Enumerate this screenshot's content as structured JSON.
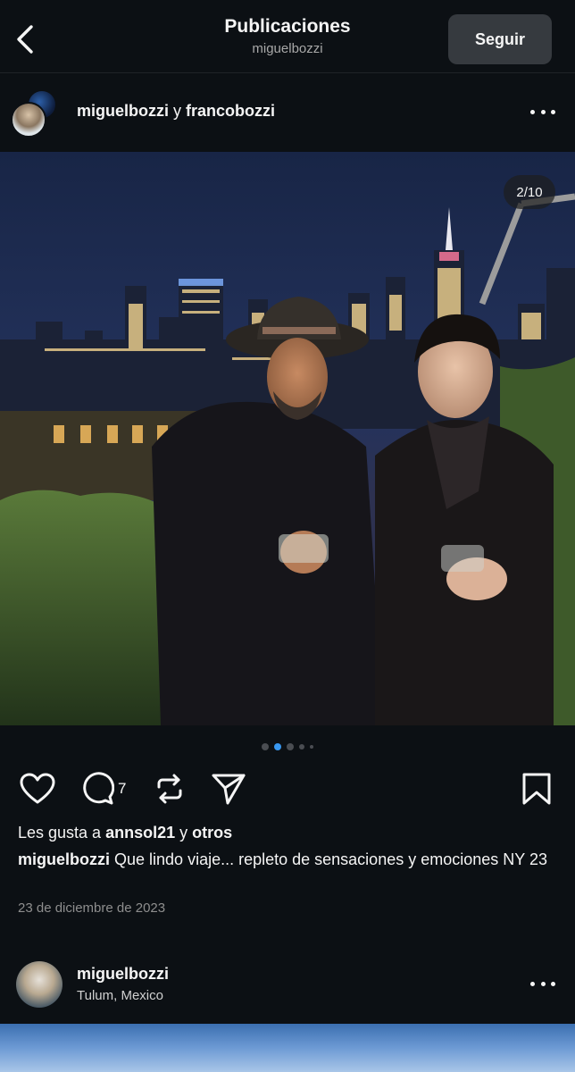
{
  "header": {
    "title": "Publicaciones",
    "subtitle": "miguelbozzi",
    "follow_label": "Seguir"
  },
  "post": {
    "user1": "miguelbozzi",
    "joiner": "y",
    "user2": "francobozzi",
    "image_counter": "2/10",
    "comment_count": "7",
    "likes_prefix": "Les gusta a",
    "likes_user": "annsol21",
    "likes_joiner": "y",
    "likes_suffix": "otros",
    "caption_user": "miguelbozzi",
    "caption_text": "Que lindo viaje... repleto de sensaciones y emociones NY 23",
    "date": "23 de diciembre de 2023"
  },
  "next_post": {
    "user": "miguelbozzi",
    "location": "Tulum, Mexico"
  },
  "colors": {
    "background": "#0c1014",
    "accent": "#3897f0",
    "button": "#363a3f"
  }
}
